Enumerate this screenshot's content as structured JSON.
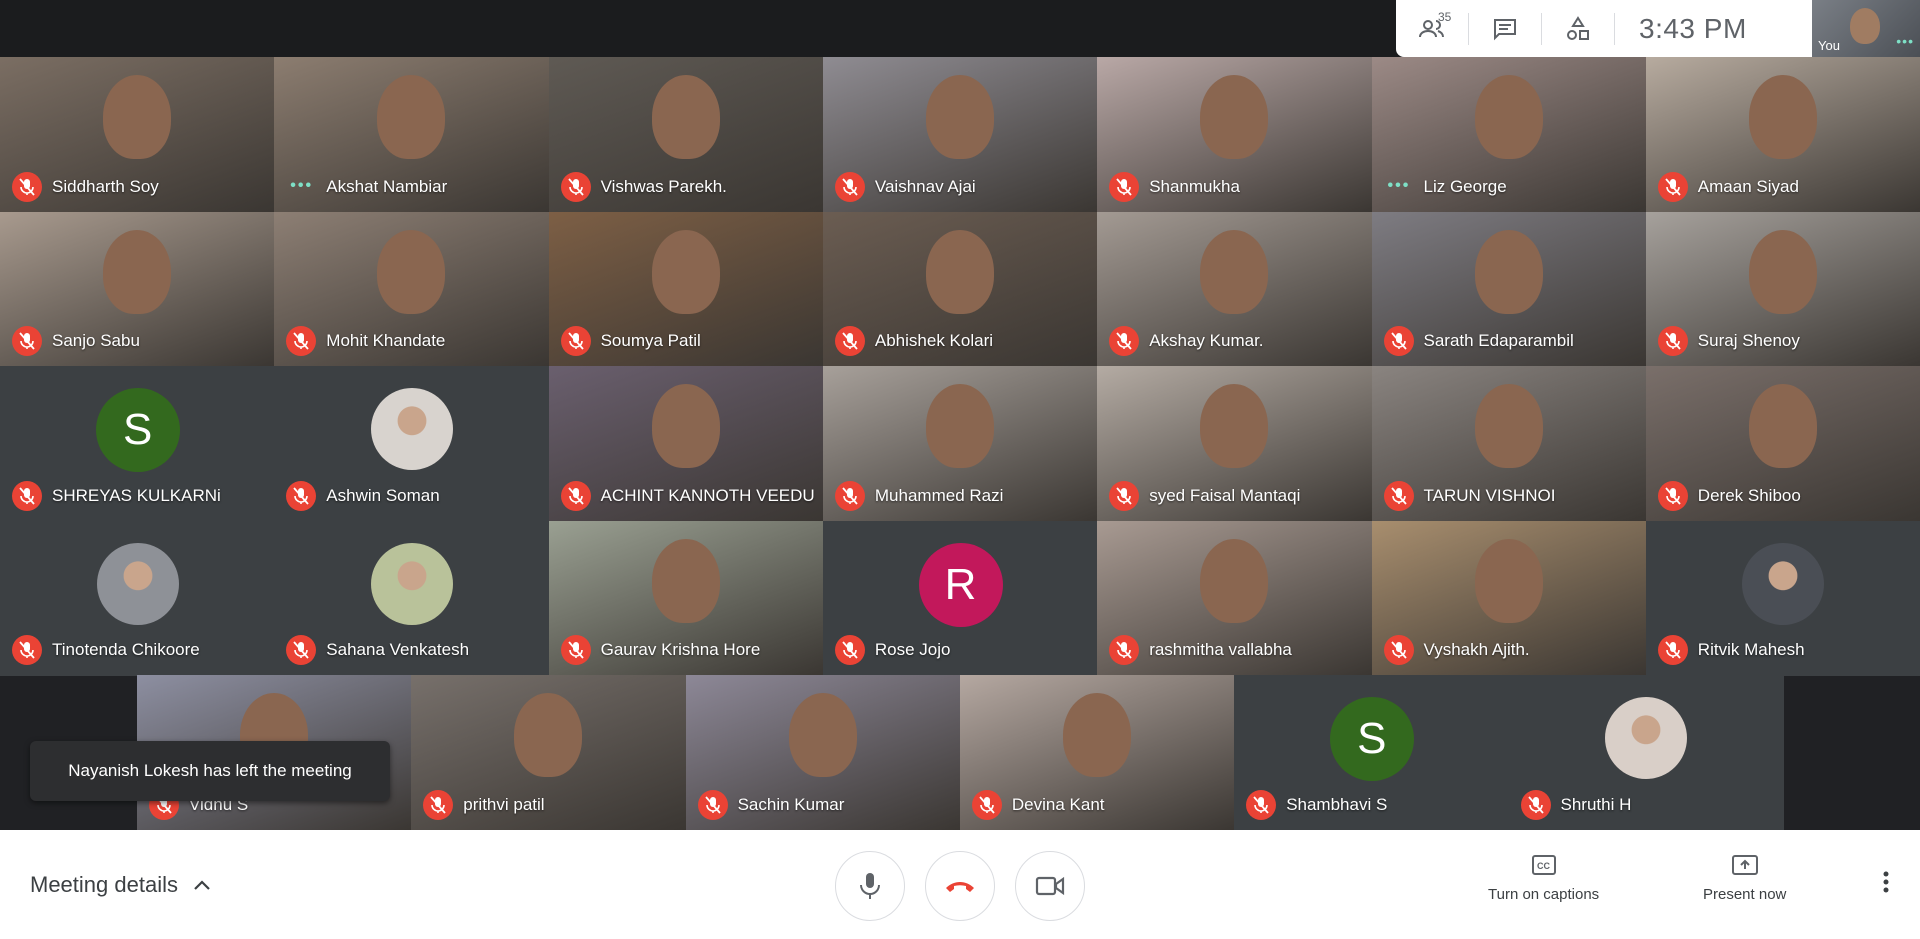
{
  "top_panel": {
    "participant_count": "35",
    "time": "3:43 PM",
    "self_label": "You",
    "icons": [
      "people-icon",
      "chat-icon",
      "activities-icon"
    ]
  },
  "participants": [
    {
      "name": "Siddharth Soy",
      "status": "muted",
      "color": "#7b6e63"
    },
    {
      "name": "Akshat Nambiar",
      "status": "speaking",
      "color": "#8c7d70"
    },
    {
      "name": "Vishwas Parekh.",
      "status": "muted",
      "color": "#5f5a54"
    },
    {
      "name": "Vaishnav Ajai",
      "status": "muted",
      "color": "#8f8c92"
    },
    {
      "name": "Shanmukha",
      "status": "muted",
      "color": "#b9a8a6"
    },
    {
      "name": "Liz George",
      "status": "speaking",
      "color": "#9c8a86"
    },
    {
      "name": "Amaan Siyad",
      "status": "muted",
      "color": "#b7ab9f"
    },
    {
      "name": "Sanjo Sabu",
      "status": "muted",
      "color": "#a89a8e"
    },
    {
      "name": "Mohit Khandate",
      "status": "muted",
      "color": "#8d7f74"
    },
    {
      "name": "Soumya Patil",
      "status": "muted",
      "color": "#7d5f45"
    },
    {
      "name": "Abhishek Kolari",
      "status": "muted",
      "color": "#6b5d52"
    },
    {
      "name": "Akshay Kumar.",
      "status": "muted",
      "color": "#a39a93"
    },
    {
      "name": "Sarath Edaparambil",
      "status": "muted",
      "color": "#7e7c82"
    },
    {
      "name": "Suraj Shenoy",
      "status": "muted",
      "color": "#a6a19c"
    },
    {
      "name": "SHREYAS KULKARNi",
      "status": "muted",
      "avatar_letter": "S",
      "avatar_color": "#33691e"
    },
    {
      "name": "Ashwin Soman",
      "status": "muted",
      "avatar_color": "#d8d3ce"
    },
    {
      "name": "ACHINT KANNOTH VEEDU",
      "status": "muted",
      "color": "#6a5f6e"
    },
    {
      "name": "Muhammed Razi",
      "status": "muted",
      "color": "#a7a09a"
    },
    {
      "name": "syed Faisal Mantaqi",
      "status": "muted",
      "color": "#b4aba3"
    },
    {
      "name": "TARUN VISHNOI",
      "status": "muted",
      "color": "#8a8480"
    },
    {
      "name": "Derek Shiboo",
      "status": "muted",
      "color": "#7a6f6a"
    },
    {
      "name": "Tinotenda Chikoore",
      "status": "muted",
      "avatar_color": "#8e9197"
    },
    {
      "name": "Sahana Venkatesh",
      "status": "muted",
      "avatar_color": "#b9c29a"
    },
    {
      "name": "Gaurav Krishna Hore",
      "status": "muted",
      "color": "#9aa092"
    },
    {
      "name": "Rose Jojo",
      "status": "muted",
      "avatar_letter": "R",
      "avatar_color": "#c2185b"
    },
    {
      "name": "rashmitha vallabha",
      "status": "muted",
      "color": "#a89a92"
    },
    {
      "name": "Vyshakh Ajith.",
      "status": "muted",
      "color": "#a88e6e"
    },
    {
      "name": "Ritvik Mahesh",
      "status": "muted",
      "avatar_color": "#4a4e55"
    },
    {
      "name": "Vidhu S",
      "status": "muted",
      "color": "#8d8fa1"
    },
    {
      "name": "prithvi patil",
      "status": "muted",
      "color": "#77706b"
    },
    {
      "name": "Sachin Kumar",
      "status": "muted",
      "color": "#8d8897"
    },
    {
      "name": "Devina Kant",
      "status": "muted",
      "color": "#b5a8a1"
    },
    {
      "name": "Shambhavi S",
      "status": "muted",
      "avatar_letter": "S",
      "avatar_color": "#33691e"
    },
    {
      "name": "Shruthi H",
      "status": "muted",
      "avatar_color": "#d9cfc8"
    }
  ],
  "toast": "Nayanish Lokesh has left the meeting",
  "bottom": {
    "meeting_details": "Meeting details",
    "captions_label": "Turn on captions",
    "present_label": "Present now",
    "accent_red": "#ea4335"
  }
}
